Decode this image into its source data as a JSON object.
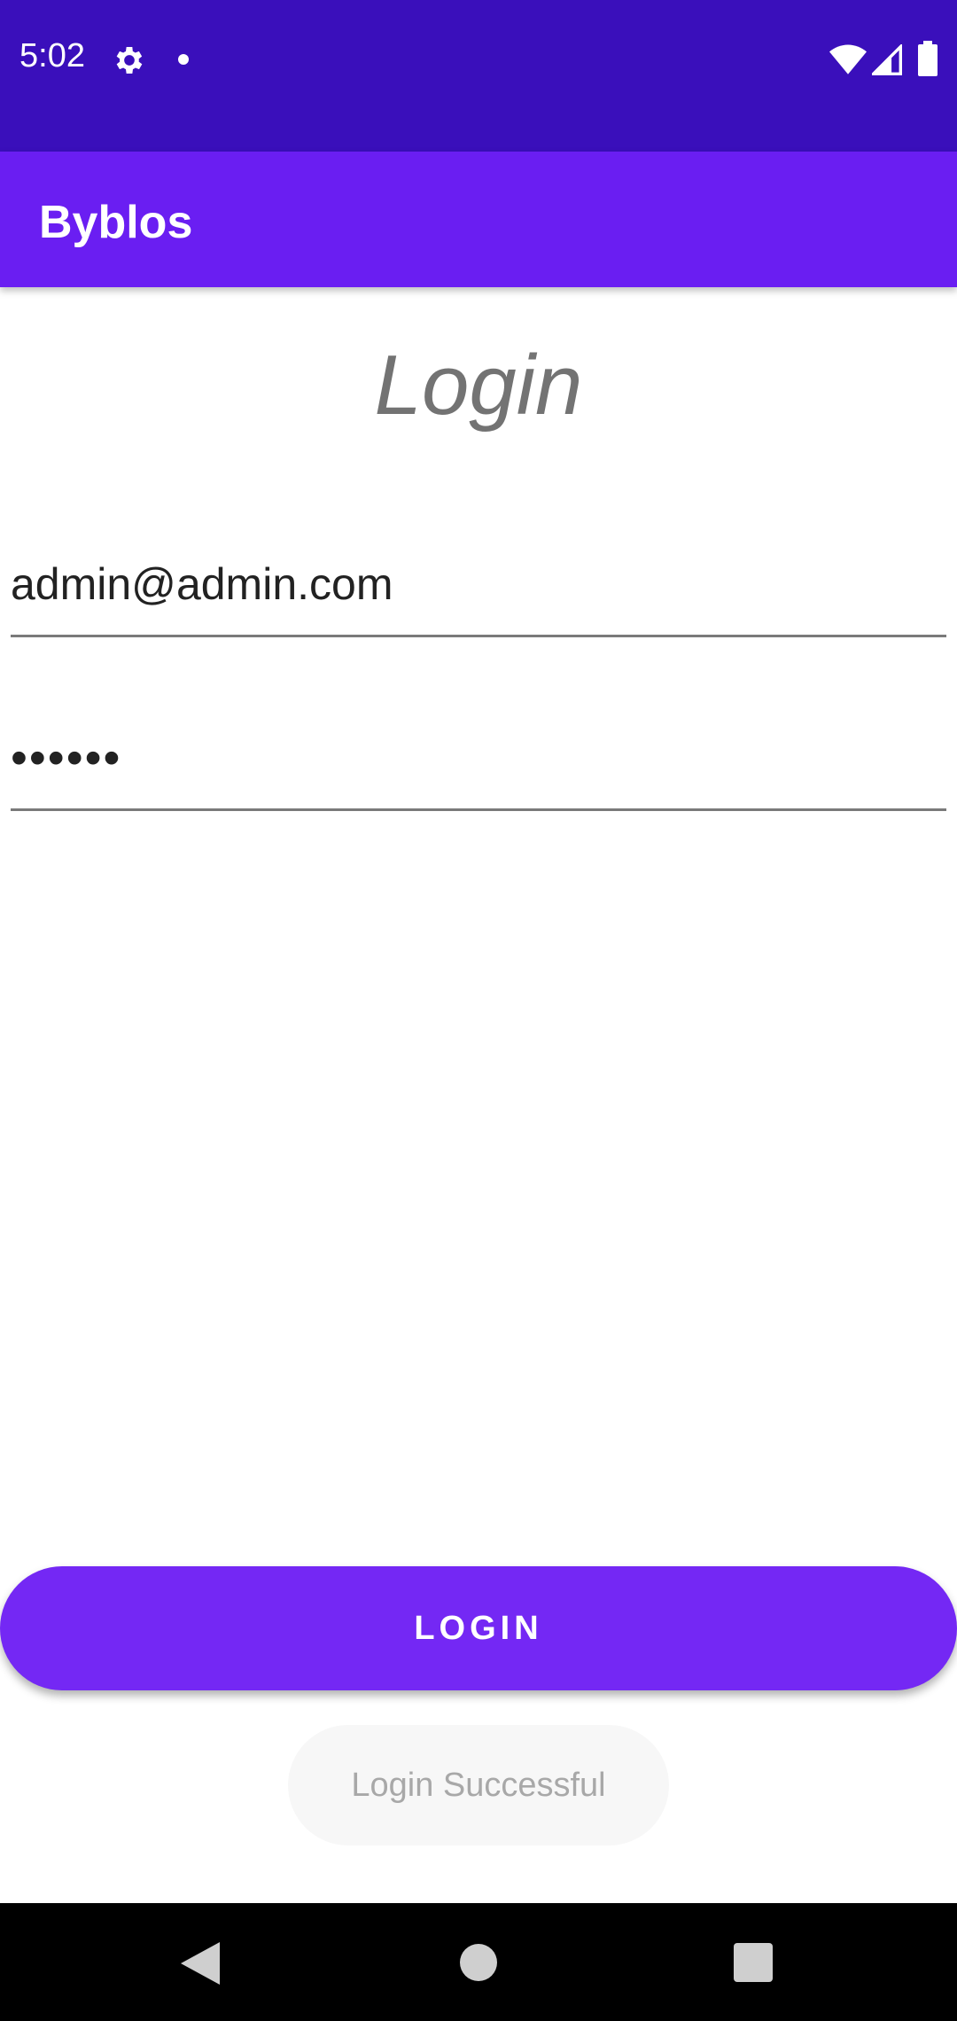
{
  "status_bar": {
    "time": "5:02",
    "icons": [
      "gear-icon",
      "notification-dot-icon",
      "wifi-icon",
      "signal-icon",
      "battery-icon"
    ]
  },
  "app_bar": {
    "title": "Byblos"
  },
  "main": {
    "heading": "Login",
    "email_value": "admin@admin.com",
    "password_value": "••••••",
    "login_button_label": "LOGIN"
  },
  "toast": {
    "message": "Login Successful"
  },
  "nav_bar": {
    "icons": [
      "back-icon",
      "home-icon",
      "recents-icon"
    ]
  },
  "colors": {
    "status_bar": "#3a0fbb",
    "app_bar": "#6a1ef2",
    "button": "#7428f4"
  }
}
